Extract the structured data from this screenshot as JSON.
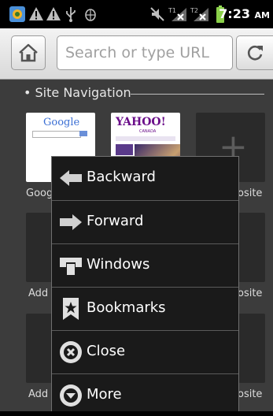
{
  "status_bar": {
    "time": "7:23",
    "ampm": "AM"
  },
  "url_bar": {
    "placeholder": "Search or type URL"
  },
  "section": {
    "title": "• Site Navigation"
  },
  "tiles": {
    "google_label": "Goog",
    "tile3_label": "osite",
    "row2_left_label": "Add",
    "row2_right_label": "osite",
    "row3_left_label": "Add",
    "row3_right_label": "osite",
    "google_logo": "Google",
    "yahoo_logo": "YAHOO!",
    "yahoo_sub": "CANADA"
  },
  "menu": {
    "items": [
      {
        "label": "Backward",
        "icon": "arrow-left-icon"
      },
      {
        "label": "Forward",
        "icon": "arrow-right-icon"
      },
      {
        "label": "Windows",
        "icon": "windows-icon"
      },
      {
        "label": "Bookmarks",
        "icon": "bookmark-star-icon"
      },
      {
        "label": "Close",
        "icon": "close-circle-icon"
      },
      {
        "label": "More",
        "icon": "more-chevron-icon"
      }
    ]
  }
}
